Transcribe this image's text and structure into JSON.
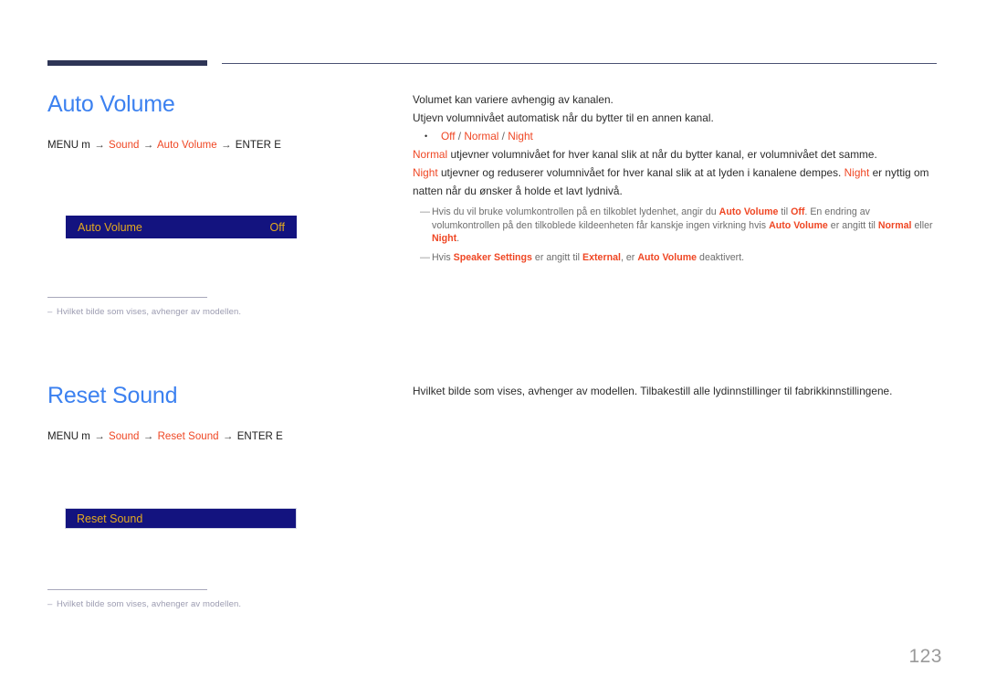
{
  "page": {
    "number": "123",
    "accent_blue": "#3c81f0",
    "accent_orange": "#ef4623",
    "osd_bg": "#13137f",
    "osd_text": "#e4aa1e",
    "rule_navy": "#2e3556"
  },
  "sections": [
    {
      "title": "Auto Volume",
      "menu_path": {
        "prefix": "MENU m",
        "arrow": "→",
        "step1": "Sound",
        "step2": "Auto Volume",
        "suffix": "ENTER E"
      },
      "osd": {
        "label": "Auto Volume",
        "value": "Off"
      },
      "footnote": {
        "dash": "–",
        "text": "Hvilket bilde som vises, avhenger av modellen."
      },
      "body": {
        "para1": "Volumet kan variere avhengig av kanalen.",
        "para2": "Utjevn volumnivået automatisk når du bytter til en annen kanal.",
        "bullet": {
          "marker": "•",
          "opt1": "Off",
          "sep1": " / ",
          "opt2": "Normal",
          "sep2": " / ",
          "opt3": "Night"
        },
        "para3_hl": "Normal",
        "para3_rest": " utjevner volumnivået for hver kanal slik at når du bytter kanal, er volumnivået det samme.",
        "para4_hl1": "Night",
        "para4_mid": " utjevner og reduserer volumnivået for hver kanal slik at at lyden i kanalene dempes. ",
        "para4_hl2": "Night",
        "para4_rest": " er nyttig om natten når du ønsker å holde et lavt lydnivå.",
        "notes": [
          {
            "marker": "—",
            "t1": "Hvis du vil bruke volumkontrollen på en tilkoblet lydenhet, angir du ",
            "h1": "Auto Volume",
            "t2": " til ",
            "h2": "Off",
            "t3": ". En endring av volumkontrollen på den tilkoblede kildeenheten får kanskje ingen virkning hvis ",
            "h3": "Auto Volume",
            "t4": " er angitt til ",
            "h4": "Normal",
            "t5": " eller ",
            "h5": "Night",
            "t6": "."
          },
          {
            "marker": "—",
            "t1": "Hvis ",
            "h1": "Speaker Settings",
            "t2": " er angitt til ",
            "h2": "External",
            "t3": ", er ",
            "h3": "Auto Volume",
            "t4": " deaktivert.",
            "h4": "",
            "t5": "",
            "h5": "",
            "t6": ""
          }
        ]
      }
    },
    {
      "title": "Reset Sound",
      "menu_path": {
        "prefix": "MENU m",
        "arrow": "→",
        "step1": "Sound",
        "step2": "Reset Sound",
        "suffix": "ENTER E"
      },
      "osd": {
        "label": "Reset Sound",
        "value": ""
      },
      "footnote": {
        "dash": "–",
        "text": "Hvilket bilde som vises, avhenger av modellen."
      },
      "body": {
        "para1": "Hvilket bilde som vises, avhenger av modellen. Tilbakestill alle lydinnstillinger til fabrikkinnstillingene."
      }
    }
  ]
}
